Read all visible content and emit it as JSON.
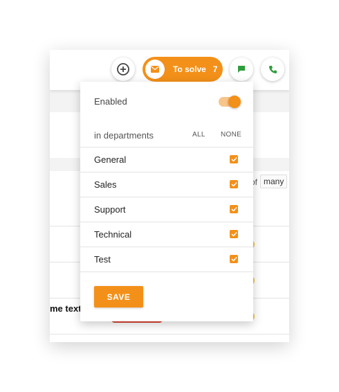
{
  "topbar": {
    "to_solve_label": "To solve",
    "to_solve_count": "7",
    "icons": {
      "add": "add-circle-icon",
      "envelope": "envelope-icon",
      "chat": "chat-icon",
      "phone": "phone-icon"
    }
  },
  "background": {
    "pager_of": "of",
    "pager_many": "many",
    "row_name_partial": "me text"
  },
  "popup": {
    "enabled_label": "Enabled",
    "enabled": true,
    "departments_label": "in departments",
    "all_label": "ALL",
    "none_label": "NONE",
    "departments": [
      {
        "name": "General",
        "checked": true
      },
      {
        "name": "Sales",
        "checked": true
      },
      {
        "name": "Support",
        "checked": true
      },
      {
        "name": "Technical",
        "checked": true
      },
      {
        "name": "Test",
        "checked": true
      }
    ],
    "save_label": "SAVE"
  },
  "colors": {
    "accent": "#f39019",
    "accent_light": "#f8c48a",
    "chat_green": "#2e9e3c",
    "danger_red": "#d9412e",
    "warning_yellow": "#f4c433"
  }
}
